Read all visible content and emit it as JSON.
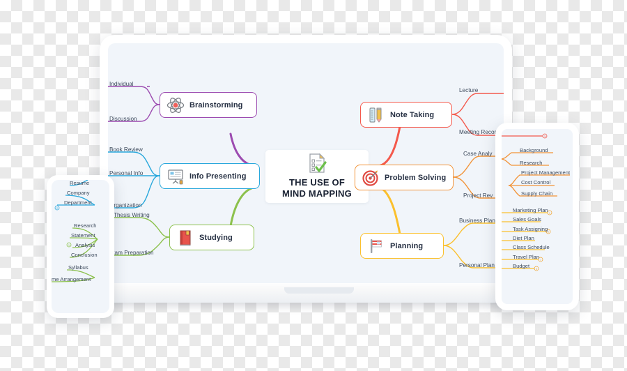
{
  "diagram": {
    "type": "mind-map",
    "center": {
      "title_line1": "THE USE OF",
      "title_line2": "MIND MAPPING",
      "icon": "checklist-document-icon"
    },
    "branches": [
      {
        "id": "brainstorming",
        "label": "Brainstorming",
        "icon": "atom-icon",
        "color": "#9c4bb0",
        "side": "left",
        "children": [
          {
            "label": "Individual"
          },
          {
            "label": "Discussion"
          }
        ]
      },
      {
        "id": "info-presenting",
        "label": "Info Presenting",
        "icon": "presentation-board-icon",
        "color": "#29a8dc",
        "side": "left",
        "children": [
          {
            "label": "Book Review"
          },
          {
            "label": "Personal Info"
          },
          {
            "label": "Organization"
          }
        ]
      },
      {
        "id": "studying",
        "label": "Studying",
        "icon": "book-icon",
        "color": "#8cc14c",
        "side": "left",
        "children": [
          {
            "label": "Thesis Writing"
          },
          {
            "label": "Exam Preparation"
          }
        ]
      },
      {
        "id": "note-taking",
        "label": "Note Taking",
        "icon": "ruler-pencil-icon",
        "color": "#f4594c",
        "side": "right",
        "children": [
          {
            "label": "Lecture"
          },
          {
            "label": "Meeting Record"
          }
        ]
      },
      {
        "id": "problem-solving",
        "label": "Problem Solving",
        "icon": "target-dart-icon",
        "color": "#f29337",
        "side": "right",
        "children": [
          {
            "label": "Case Analysis"
          },
          {
            "label": "Project Review"
          }
        ]
      },
      {
        "id": "planning",
        "label": "Planning",
        "icon": "flag-icon",
        "color": "#fbc02d",
        "side": "right",
        "children": [
          {
            "label": "Business Plan"
          },
          {
            "label": "Personal Plan"
          }
        ]
      }
    ]
  },
  "laptop": {
    "center_title_line1": "THE USE OF",
    "center_title_line2": "MIND MAPPING",
    "nodes": {
      "brainstorming": "Brainstorming",
      "info_presenting": "Info Presenting",
      "studying": "Studying",
      "note_taking": "Note Taking",
      "problem_solving": "Problem Solving",
      "planning": "Planning"
    },
    "leaves": {
      "individual": "Individual",
      "discussion": "Discussion",
      "book_review": "Book Review",
      "personal_info": "Personal Info",
      "organization": "Organization",
      "thesis_writing": "Thesis Writing",
      "exam_preparation": "Exam Preparation",
      "lecture": "Lecture",
      "meeting_record": "Meeting Record",
      "case_analysis": "Case Analy",
      "project_review": "Project Rev",
      "business_plan": "Business Plan",
      "personal_plan": "Personal Plan"
    }
  },
  "tablet": {
    "items": [
      {
        "label": "Background",
        "color": "#f29337",
        "badge": ""
      },
      {
        "label": "Research",
        "color": "#f29337",
        "badge": ""
      },
      {
        "label": "Project Management",
        "color": "#f29337",
        "badge": ""
      },
      {
        "label": "Cost Control",
        "color": "#f29337",
        "badge": ""
      },
      {
        "label": "Supply Chain",
        "color": "#f29337",
        "badge": ""
      },
      {
        "label": "Marketing Plan",
        "color": "#fbc02d",
        "badge": "1"
      },
      {
        "label": "Sales Goals",
        "color": "#fbc02d",
        "badge": ""
      },
      {
        "label": "Task Assigning",
        "color": "#fbc02d",
        "badge": "2"
      },
      {
        "label": "Diet Plan",
        "color": "#fbc02d",
        "badge": ""
      },
      {
        "label": "Class Schedule",
        "color": "#fbc02d",
        "badge": ""
      },
      {
        "label": "Travel Plan",
        "color": "#fbc02d",
        "badge": "7"
      },
      {
        "label": "Budget",
        "color": "#fbc02d",
        "badge": "3"
      }
    ],
    "top_badge": "3"
  },
  "phone": {
    "items": [
      {
        "label": "Resume",
        "color": "#29a8dc",
        "badge": ""
      },
      {
        "label": "Company",
        "color": "#29a8dc",
        "badge": ""
      },
      {
        "label": "Department",
        "color": "#29a8dc",
        "badge": "2"
      },
      {
        "label": "Research",
        "color": "#8cc14c",
        "badge": ""
      },
      {
        "label": "Statement",
        "color": "#8cc14c",
        "badge": ""
      },
      {
        "label": "Analysis",
        "color": "#8cc14c",
        "badge": "1"
      },
      {
        "label": "Conclusion",
        "color": "#8cc14c",
        "badge": ""
      },
      {
        "label": "Syllabus",
        "color": "#8cc14c",
        "badge": ""
      },
      {
        "label": "Time Arrangement",
        "color": "#8cc14c",
        "badge": ""
      }
    ],
    "cut_labels": {
      "organization": "Organization",
      "thesis": "Thesis",
      "exam_prep": "Exam Pr"
    }
  },
  "colors": {
    "purple": "#9c4bb0",
    "cyan": "#29a8dc",
    "green": "#8cc14c",
    "red": "#f4594c",
    "orange": "#f29337",
    "yellow": "#fbc02d",
    "screen_bg": "#f1f5fa",
    "text": "#263043"
  }
}
